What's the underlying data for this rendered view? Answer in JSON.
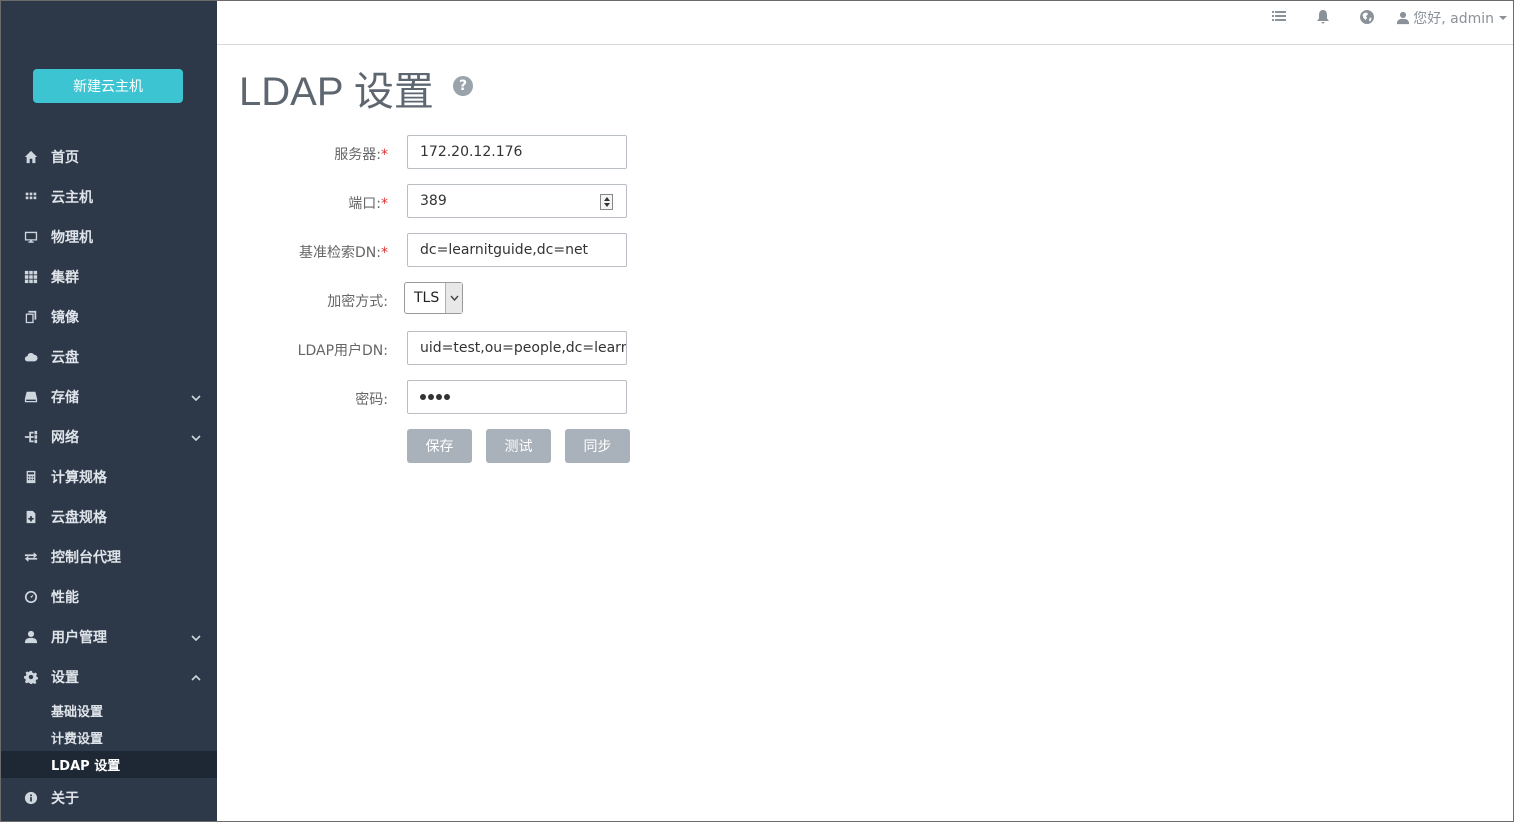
{
  "sidebar": {
    "new_button": "新建云主机",
    "items": [
      {
        "label": "首页",
        "icon": "home-icon"
      },
      {
        "label": "云主机",
        "icon": "th-icon"
      },
      {
        "label": "物理机",
        "icon": "monitor-icon"
      },
      {
        "label": "集群",
        "icon": "grid-icon"
      },
      {
        "label": "镜像",
        "icon": "copy-icon"
      },
      {
        "label": "云盘",
        "icon": "cloud-icon"
      },
      {
        "label": "存储",
        "icon": "hdd-icon",
        "expandable": true
      },
      {
        "label": "网络",
        "icon": "network-icon",
        "expandable": true
      },
      {
        "label": "计算规格",
        "icon": "calculator-icon"
      },
      {
        "label": "云盘规格",
        "icon": "file-icon"
      },
      {
        "label": "控制台代理",
        "icon": "exchange-icon"
      },
      {
        "label": "性能",
        "icon": "dashboard-icon"
      },
      {
        "label": "用户管理",
        "icon": "user-icon",
        "expandable": true
      },
      {
        "label": "设置",
        "icon": "gear-icon",
        "expanded": true
      }
    ],
    "settings_sub": [
      "基础设置",
      "计费设置",
      "LDAP 设置"
    ],
    "about": "关于"
  },
  "topbar": {
    "greeting": "您好, admin"
  },
  "page": {
    "title": "LDAP 设置"
  },
  "form": {
    "server_label": "服务器:",
    "server_value": "172.20.12.176",
    "port_label": "端口:",
    "port_value": "389",
    "base_dn_label": "基准检索DN:",
    "base_dn_value": "dc=learnitguide,dc=net",
    "encryption_label": "加密方式:",
    "encryption_value": "TLS",
    "user_dn_label": "LDAP用户DN:",
    "user_dn_value": "uid=test,ou=people,dc=learnitg",
    "password_label": "密码:",
    "required_mark": "*"
  },
  "buttons": {
    "save": "保存",
    "test": "测试",
    "sync": "同步"
  },
  "colors": {
    "sidebar_bg": "#2d3848",
    "accent": "#3cc4d2",
    "button_disabled": "#a9b1bb",
    "required": "#e03030"
  }
}
